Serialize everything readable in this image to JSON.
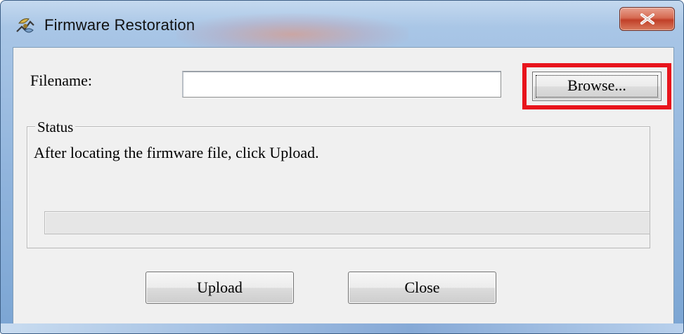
{
  "window": {
    "title": "Firmware Restoration",
    "app_icon": "firmware-restoration-icon",
    "close_icon": "close-x-icon",
    "close_button_color": "#c13f28"
  },
  "form": {
    "filename_label": "Filename:",
    "filename_value": "",
    "browse_label": "Browse...",
    "highlight_color": "#e8141c"
  },
  "status": {
    "legend": "Status",
    "message": "After locating the firmware file, click Upload.",
    "progress_percent": 0
  },
  "buttons": {
    "upload_label": "Upload",
    "close_label": "Close"
  }
}
